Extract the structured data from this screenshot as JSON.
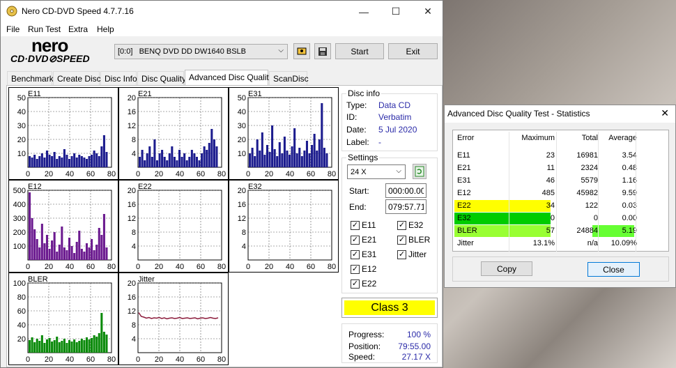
{
  "window": {
    "title": "Nero CD-DVD Speed 4.7.7.16",
    "minimize": "—",
    "maximize": "☐",
    "close": "✕"
  },
  "menu": [
    "File",
    "Run Test",
    "Extra",
    "Help"
  ],
  "logo": {
    "brand": "nero",
    "product": "CD·DVD⊘SPEED"
  },
  "toolbar": {
    "drive": "[0:0]   BENQ DVD DD DW1640 BSLB",
    "start": "Start",
    "exit": "Exit"
  },
  "tabs": [
    "Benchmark",
    "Create Disc",
    "Disc Info",
    "Disc Quality",
    "Advanced Disc Quality",
    "ScanDisc"
  ],
  "active_tab": 4,
  "disc_info": {
    "title": "Disc info",
    "type_label": "Type:",
    "type": "Data CD",
    "id_label": "ID:",
    "id": "Verbatim",
    "date_label": "Date:",
    "date": "5 Jul 2020",
    "label_label": "Label:",
    "label": "-"
  },
  "settings": {
    "title": "Settings",
    "speed": "24 X",
    "start_label": "Start:",
    "start": "000:00.00",
    "end_label": "End:",
    "end": "079:57.71",
    "checkboxes": {
      "e11": "E11",
      "e32": "E32",
      "e21": "E21",
      "bler": "BLER",
      "e31": "E31",
      "jitter": "Jitter",
      "e12": "E12",
      "e22": "E22"
    }
  },
  "class_label": "Class 3",
  "progress": {
    "progress_label": "Progress:",
    "progress": "100 %",
    "position_label": "Position:",
    "position": "79:55.00",
    "speed_label": "Speed:",
    "speed": "27.17 X"
  },
  "colors": {
    "navy": "#1c1c8e",
    "purple": "#6b1a8f",
    "green": "#0a8a0a",
    "jitter": "#8b1a3a",
    "class_bg": "#ffff00",
    "e22_bg": "#ffff00",
    "e32_bg": "#00cc00",
    "bler_bg": "#99ff33",
    "avg_bg": "#66ff33"
  },
  "chart_data": [
    {
      "type": "bar",
      "name": "E11",
      "x_ticks": [
        "0",
        "20",
        "40",
        "60",
        "80"
      ],
      "y_ticks": [
        "50",
        "40",
        "30",
        "20",
        "10"
      ],
      "ylim": [
        0,
        50
      ],
      "xlim": [
        0,
        80
      ],
      "color": "navy",
      "values": [
        8,
        7,
        9,
        6,
        8,
        10,
        7,
        12,
        9,
        8,
        11,
        6,
        8,
        7,
        13,
        9,
        6,
        8,
        10,
        7,
        9,
        8,
        7,
        6,
        8,
        9,
        12,
        10,
        8,
        15,
        23,
        11
      ]
    },
    {
      "type": "bar",
      "name": "E21",
      "x_ticks": [
        "0",
        "20",
        "40",
        "60",
        "80"
      ],
      "y_ticks": [
        "20",
        "16",
        "12",
        "8",
        "4"
      ],
      "ylim": [
        0,
        20
      ],
      "xlim": [
        0,
        80
      ],
      "color": "navy",
      "values": [
        3,
        5,
        2,
        4,
        6,
        3,
        8,
        2,
        4,
        5,
        3,
        2,
        4,
        6,
        3,
        2,
        5,
        3,
        4,
        2,
        3,
        5,
        4,
        3,
        2,
        4,
        6,
        5,
        7,
        11,
        8,
        6
      ]
    },
    {
      "type": "bar",
      "name": "E31",
      "x_ticks": [
        "0",
        "20",
        "40",
        "60",
        "80"
      ],
      "y_ticks": [
        "50",
        "40",
        "30",
        "20",
        "10"
      ],
      "ylim": [
        0,
        50
      ],
      "xlim": [
        0,
        80
      ],
      "color": "navy",
      "values": [
        10,
        14,
        8,
        20,
        12,
        25,
        9,
        16,
        11,
        30,
        13,
        8,
        18,
        10,
        22,
        12,
        9,
        15,
        28,
        10,
        14,
        8,
        12,
        19,
        10,
        16,
        24,
        12,
        20,
        46,
        14,
        10
      ]
    },
    {
      "type": "bar",
      "name": "E12",
      "x_ticks": [
        "0",
        "20",
        "40",
        "60",
        "80"
      ],
      "y_ticks": [
        "500",
        "400",
        "300",
        "200",
        "100"
      ],
      "ylim": [
        0,
        500
      ],
      "xlim": [
        0,
        80
      ],
      "color": "purple",
      "values": [
        485,
        300,
        220,
        150,
        90,
        260,
        120,
        180,
        80,
        140,
        200,
        60,
        110,
        240,
        90,
        70,
        160,
        100,
        50,
        130,
        210,
        80,
        60,
        120,
        90,
        150,
        70,
        110,
        230,
        180,
        330,
        90
      ]
    },
    {
      "type": "bar",
      "name": "E22",
      "x_ticks": [
        "0",
        "20",
        "40",
        "60",
        "80"
      ],
      "y_ticks": [
        "20",
        "16",
        "12",
        "8",
        "4"
      ],
      "ylim": [
        0,
        20
      ],
      "xlim": [
        0,
        80
      ],
      "color": "purple",
      "values": [
        0,
        0,
        0,
        0,
        0,
        0,
        0,
        0,
        0,
        0,
        0,
        0,
        0,
        0,
        0,
        0,
        0,
        0,
        0,
        0,
        0,
        0,
        0,
        0,
        0,
        0,
        0,
        0,
        0,
        0,
        0,
        0
      ]
    },
    {
      "type": "bar",
      "name": "E32",
      "x_ticks": [
        "0",
        "20",
        "40",
        "60",
        "80"
      ],
      "y_ticks": [
        "20",
        "16",
        "12",
        "8",
        "4"
      ],
      "ylim": [
        0,
        20
      ],
      "xlim": [
        0,
        80
      ],
      "color": "purple",
      "values": [
        0,
        0,
        0,
        0,
        0,
        0,
        0,
        0,
        0,
        0,
        0,
        0,
        0,
        0,
        0,
        0,
        0,
        0,
        0,
        0,
        0,
        0,
        0,
        0,
        0,
        0,
        0,
        0,
        0,
        0,
        0,
        0
      ]
    },
    {
      "type": "bar",
      "name": "BLER",
      "x_ticks": [
        "0",
        "20",
        "40",
        "60",
        "80"
      ],
      "y_ticks": [
        "100",
        "80",
        "60",
        "40",
        "20"
      ],
      "ylim": [
        0,
        100
      ],
      "xlim": [
        0,
        80
      ],
      "color": "green",
      "values": [
        18,
        22,
        15,
        20,
        17,
        25,
        14,
        19,
        21,
        16,
        18,
        23,
        15,
        17,
        20,
        14,
        18,
        16,
        19,
        15,
        17,
        20,
        18,
        22,
        19,
        21,
        25,
        23,
        28,
        57,
        30,
        26
      ]
    },
    {
      "type": "line",
      "name": "Jitter",
      "x_ticks": [
        "0",
        "20",
        "40",
        "60",
        "80"
      ],
      "y_ticks": [
        "20",
        "16",
        "12",
        "8",
        "4"
      ],
      "ylim": [
        0,
        20
      ],
      "xlim": [
        0,
        80
      ],
      "color": "jitter",
      "values": [
        11.5,
        10.4,
        10.2,
        9.9,
        10.1,
        9.8,
        10.0,
        9.9,
        10.1,
        9.8,
        10.0,
        9.7,
        9.9,
        10.0,
        9.8,
        9.9,
        10.1,
        9.8,
        9.9,
        10.0,
        9.8,
        9.9,
        10.0,
        9.7,
        9.9,
        10.0,
        9.8,
        9.9,
        10.1,
        9.9,
        9.8,
        10.0
      ]
    }
  ],
  "stats": {
    "title": "Advanced Disc Quality Test - Statistics",
    "headers": [
      "Error",
      "Maximum",
      "Total",
      "Average"
    ],
    "rows": [
      {
        "error": "E11",
        "max": "23",
        "total": "16981",
        "avg": "3.54"
      },
      {
        "error": "E21",
        "max": "11",
        "total": "2324",
        "avg": "0.48"
      },
      {
        "error": "E31",
        "max": "46",
        "total": "5579",
        "avg": "1.16"
      },
      {
        "error": "E12",
        "max": "485",
        "total": "45982",
        "avg": "9.59"
      },
      {
        "error": "E22",
        "max": "34",
        "total": "122",
        "avg": "0.03"
      },
      {
        "error": "E32",
        "max": "0",
        "total": "0",
        "avg": "0.00"
      },
      {
        "error": "BLER",
        "max": "57",
        "total": "24884",
        "avg": "5.19"
      },
      {
        "error": "Jitter",
        "max": "13.1%",
        "total": "n/a",
        "avg": "10.09%"
      }
    ],
    "copy": "Copy",
    "close": "Close"
  }
}
